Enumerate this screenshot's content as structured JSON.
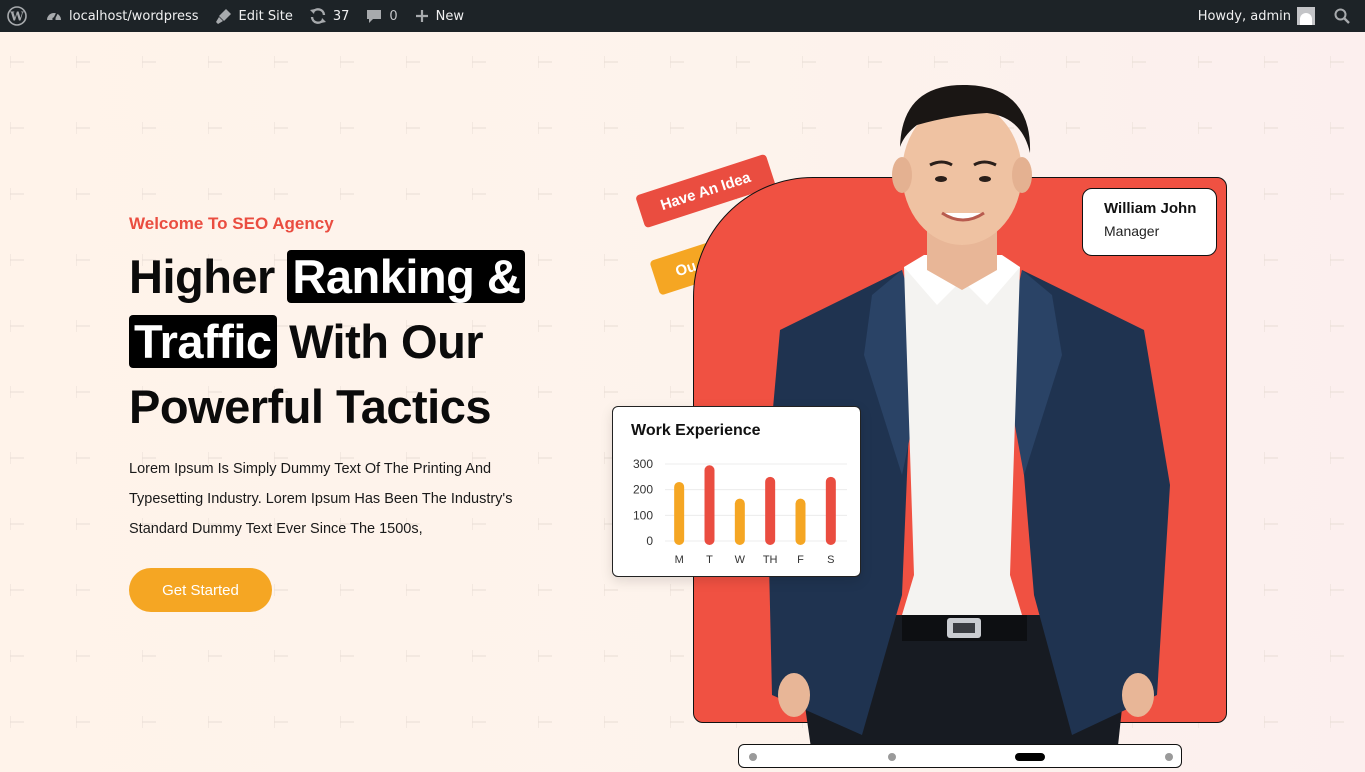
{
  "adminbar": {
    "site_name": "localhost/wordpress",
    "edit_site": "Edit Site",
    "updates_count": "37",
    "comments_count": "0",
    "new_label": "New",
    "howdy": "Howdy, admin"
  },
  "hero": {
    "welcome": "Welcome To SEO Agency",
    "headline": {
      "part1": "Higher ",
      "highlight1": "Ranking &",
      "highlight2": "Traffic",
      "part2": " With Our Powerful Tactics"
    },
    "description": "Lorem Ipsum Is Simply Dummy Text Of The Printing And Typesetting Industry. Lorem Ipsum Has Been The Industry's Standard Dummy Text Ever Since The 1500s,",
    "cta_label": "Get Started"
  },
  "visual": {
    "tag_red": "Have An Idea",
    "tag_yellow": "Ou",
    "name_card": {
      "name": "William John",
      "role": "Manager"
    },
    "slider": {
      "dots": 4,
      "active_index": 2
    }
  },
  "chart_data": {
    "type": "bar",
    "title": "Work Experience",
    "categories": [
      "M",
      "T",
      "W",
      "TH",
      "F",
      "S"
    ],
    "values": [
      230,
      295,
      165,
      250,
      165,
      250
    ],
    "bar_colors": [
      "#f5a623",
      "#ea4d40",
      "#f5a623",
      "#ea4d40",
      "#f5a623",
      "#ea4d40"
    ],
    "yticks": [
      0,
      100,
      200,
      300
    ],
    "ylim": [
      0,
      300
    ],
    "grid": true
  },
  "colors": {
    "accent_red": "#ea4d40",
    "accent_yellow": "#f5a623",
    "admin_bar": "#1d2327"
  }
}
